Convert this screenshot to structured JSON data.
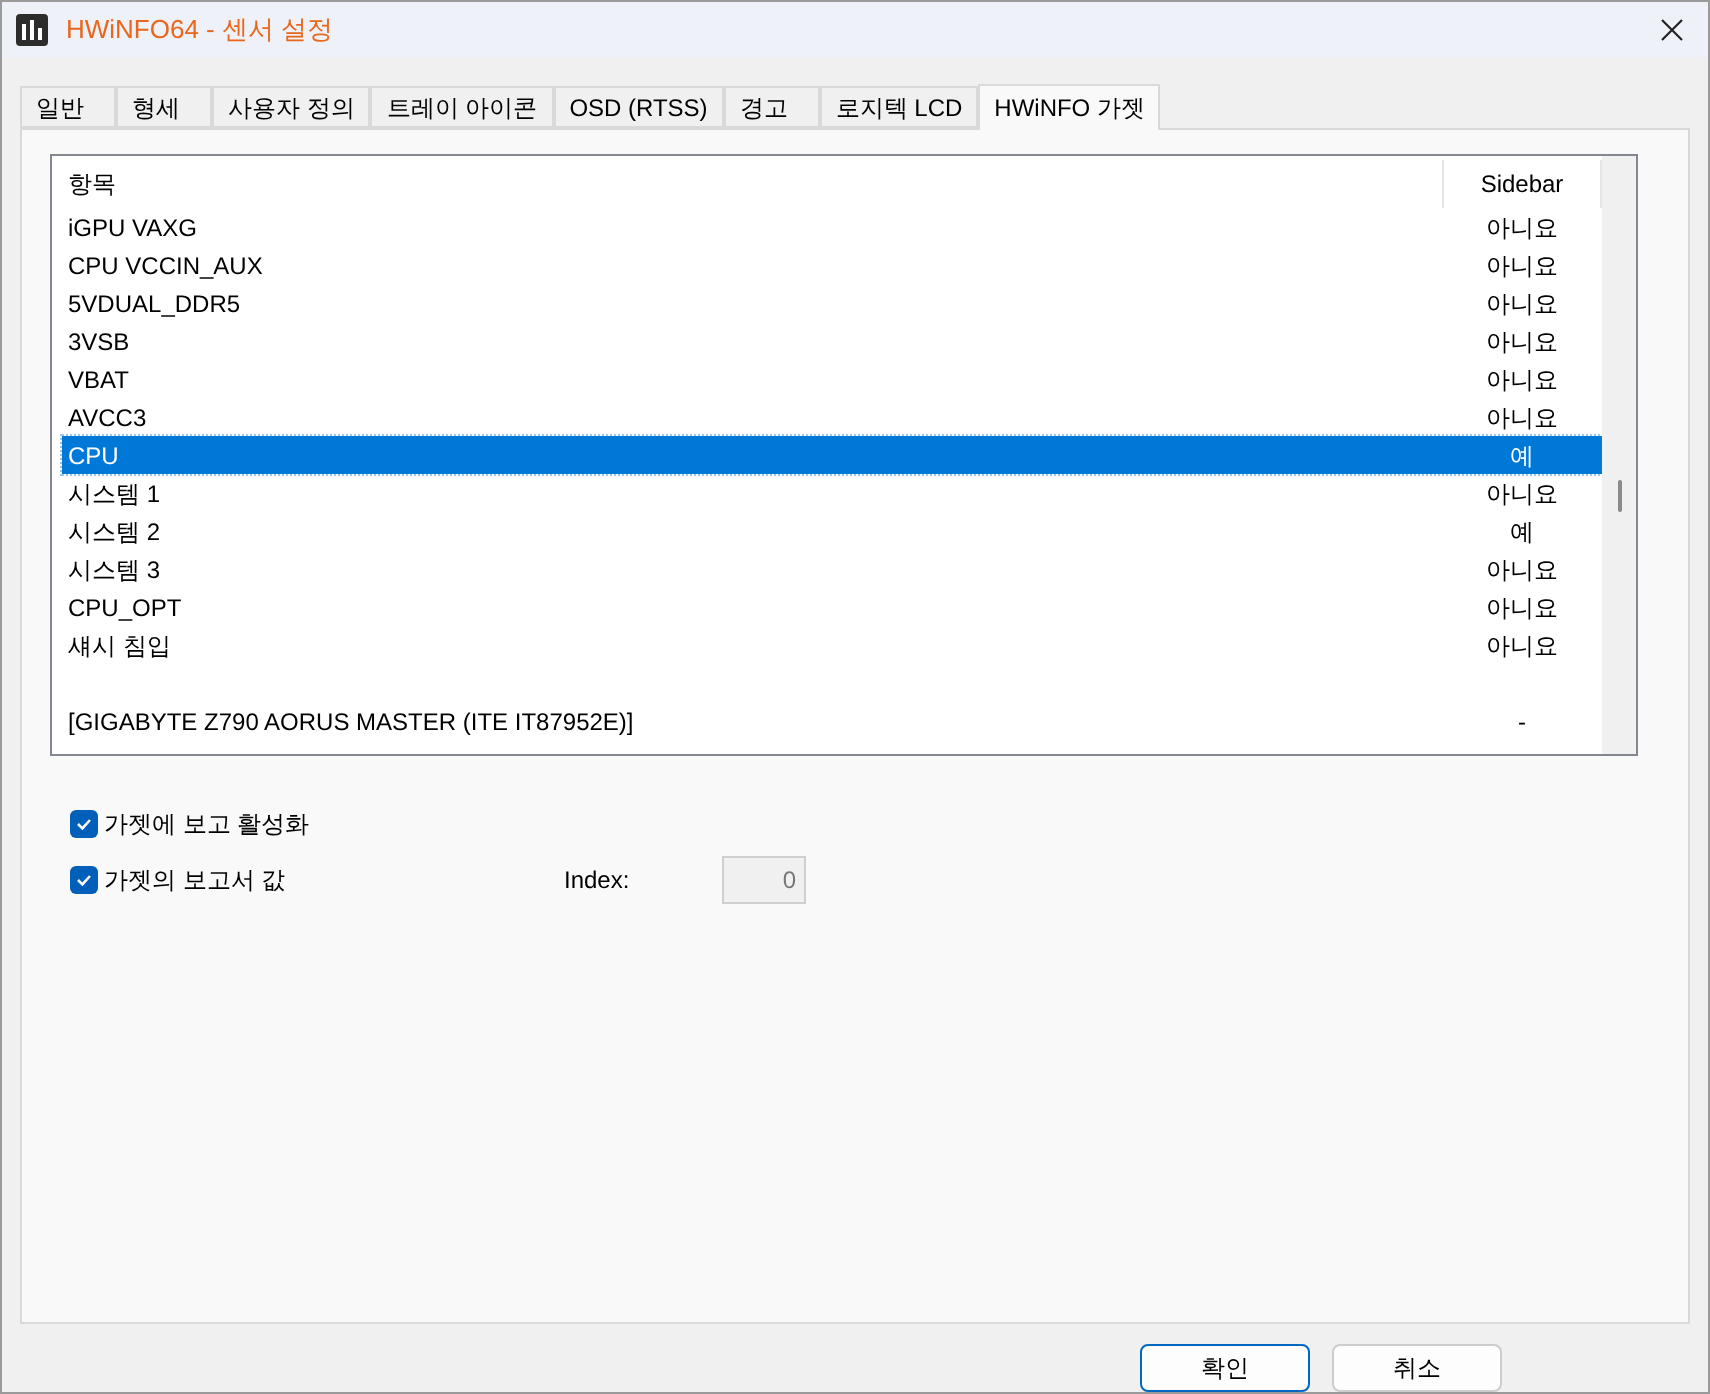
{
  "window": {
    "title": "HWiNFO64 - 센서 설정"
  },
  "tabs": [
    {
      "label": "일반",
      "selected": false
    },
    {
      "label": "형세",
      "selected": false
    },
    {
      "label": "사용자 정의",
      "selected": false
    },
    {
      "label": "트레이 아이콘",
      "selected": false
    },
    {
      "label": "OSD (RTSS)",
      "selected": false
    },
    {
      "label": "경고",
      "selected": false
    },
    {
      "label": "로지텍 LCD",
      "selected": false
    },
    {
      "label": "HWiNFO 가젯",
      "selected": true
    }
  ],
  "table": {
    "columns": [
      "항목",
      "Sidebar"
    ],
    "rows": [
      {
        "item": "iGPU VAXG",
        "sidebar": "아니요",
        "selected": false
      },
      {
        "item": "CPU VCCIN_AUX",
        "sidebar": "아니요",
        "selected": false
      },
      {
        "item": "5VDUAL_DDR5",
        "sidebar": "아니요",
        "selected": false
      },
      {
        "item": "3VSB",
        "sidebar": "아니요",
        "selected": false
      },
      {
        "item": "VBAT",
        "sidebar": "아니요",
        "selected": false
      },
      {
        "item": "AVCC3",
        "sidebar": "아니요",
        "selected": false
      },
      {
        "item": "CPU",
        "sidebar": "예",
        "selected": true
      },
      {
        "item": "시스템 1",
        "sidebar": "아니요",
        "selected": false
      },
      {
        "item": "시스템 2",
        "sidebar": "예",
        "selected": false
      },
      {
        "item": "시스템 3",
        "sidebar": "아니요",
        "selected": false
      },
      {
        "item": "CPU_OPT",
        "sidebar": "아니요",
        "selected": false
      },
      {
        "item": "섀시 침입",
        "sidebar": "아니요",
        "selected": false
      },
      {
        "item": "[GIGABYTE Z790 AORUS MASTER (ITE IT87952E)]",
        "sidebar": "-",
        "selected": false,
        "kind": "group"
      }
    ]
  },
  "options": [
    {
      "label": "가젯에 보고 활성화",
      "checked": true
    },
    {
      "label": "가젯의 보고서 값",
      "checked": true
    }
  ],
  "index": {
    "label": "Index:",
    "value": "0"
  },
  "buttons": [
    {
      "label": "확인",
      "default": true
    },
    {
      "label": "취소",
      "default": false
    }
  ]
}
